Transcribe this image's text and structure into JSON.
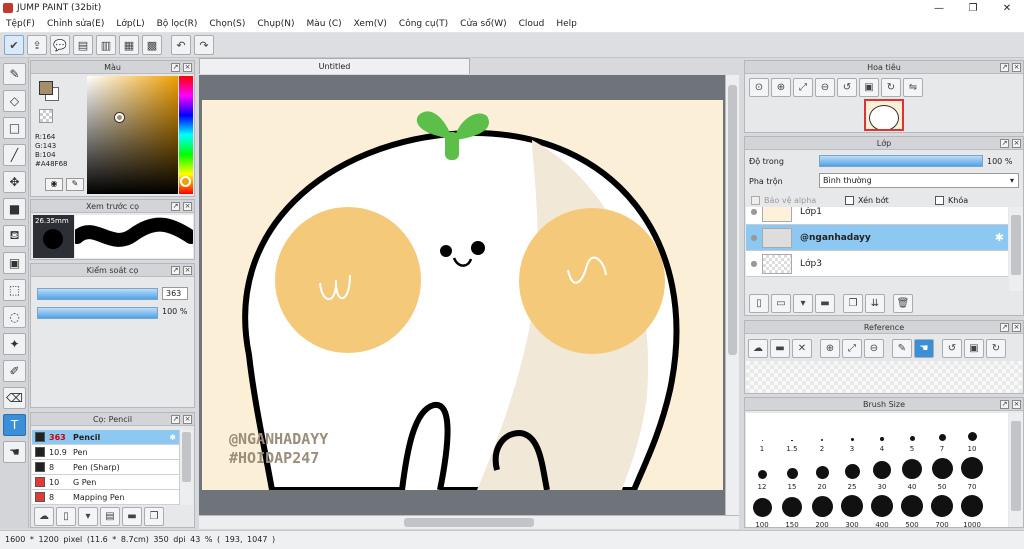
{
  "window": {
    "title": "JUMP PAINT (32bit)"
  },
  "menu": [
    "Tệp(F)",
    "Chỉnh sửa(E)",
    "Lớp(L)",
    "Bộ lọc(R)",
    "Chọn(S)",
    "Chụp(N)",
    "Màu (C)",
    "Xem(V)",
    "Công cụ(T)",
    "Cửa sổ(W)",
    "Cloud",
    "Help"
  ],
  "color_panel": {
    "title": "Màu",
    "r": "R:164",
    "g": "G:143",
    "b": "B:104",
    "hex": "#A48F68",
    "fg_color": "#A48F68"
  },
  "brush_preview": {
    "title": "Xem trước cọ",
    "size": "26.35mm"
  },
  "brush_control": {
    "title": "Kiểm soát cọ",
    "size_value": "363",
    "opacity_value": "100 %"
  },
  "brush_list": {
    "title": "Cọ: Pencil",
    "items": [
      {
        "size": "363",
        "name": "Pencil",
        "color": "#222222",
        "selected": true
      },
      {
        "size": "10.9",
        "name": "Pen",
        "color": "#222222",
        "selected": false
      },
      {
        "size": "8",
        "name": "Pen (Sharp)",
        "color": "#222222",
        "selected": false
      },
      {
        "size": "10",
        "name": "G Pen",
        "color": "#e53935",
        "selected": false
      },
      {
        "size": "8",
        "name": "Mapping Pen",
        "color": "#e53935",
        "selected": false
      }
    ]
  },
  "document": {
    "tab": "Untitled",
    "watermark_1": "@NGANHADAYY",
    "watermark_2": "#HOIDAP247"
  },
  "navigator": {
    "title": "Hoa tiêu"
  },
  "layers": {
    "title": "Lớp",
    "opacity_label": "Độ trong",
    "opacity_value": "100 %",
    "blend_label": "Pha trộn",
    "blend_value": "Bình thường",
    "protect_alpha": "Bảo vệ alpha",
    "clip": "Xén bớt",
    "lock": "Khóa",
    "items": [
      {
        "name": "Lớp1",
        "selected": false
      },
      {
        "name": "@nganhadayy",
        "selected": true
      },
      {
        "name": "Lớp3",
        "selected": false
      }
    ]
  },
  "reference": {
    "title": "Reference"
  },
  "brush_size": {
    "title": "Brush Size",
    "sizes": [
      "1",
      "1.5",
      "2",
      "3",
      "4",
      "5",
      "7",
      "10",
      "12",
      "15",
      "20",
      "25",
      "30",
      "40",
      "50",
      "70",
      "100",
      "150",
      "200",
      "300",
      "400",
      "500",
      "700",
      "1000"
    ]
  },
  "status": {
    "text": "1600 * 1200 pixel   (11.6 * 8.7cm)   350 dpi   43 %   ( 193, 1047 )"
  },
  "colors": {
    "accent": "#3b8ed8",
    "selection": "#8cc8f2"
  }
}
